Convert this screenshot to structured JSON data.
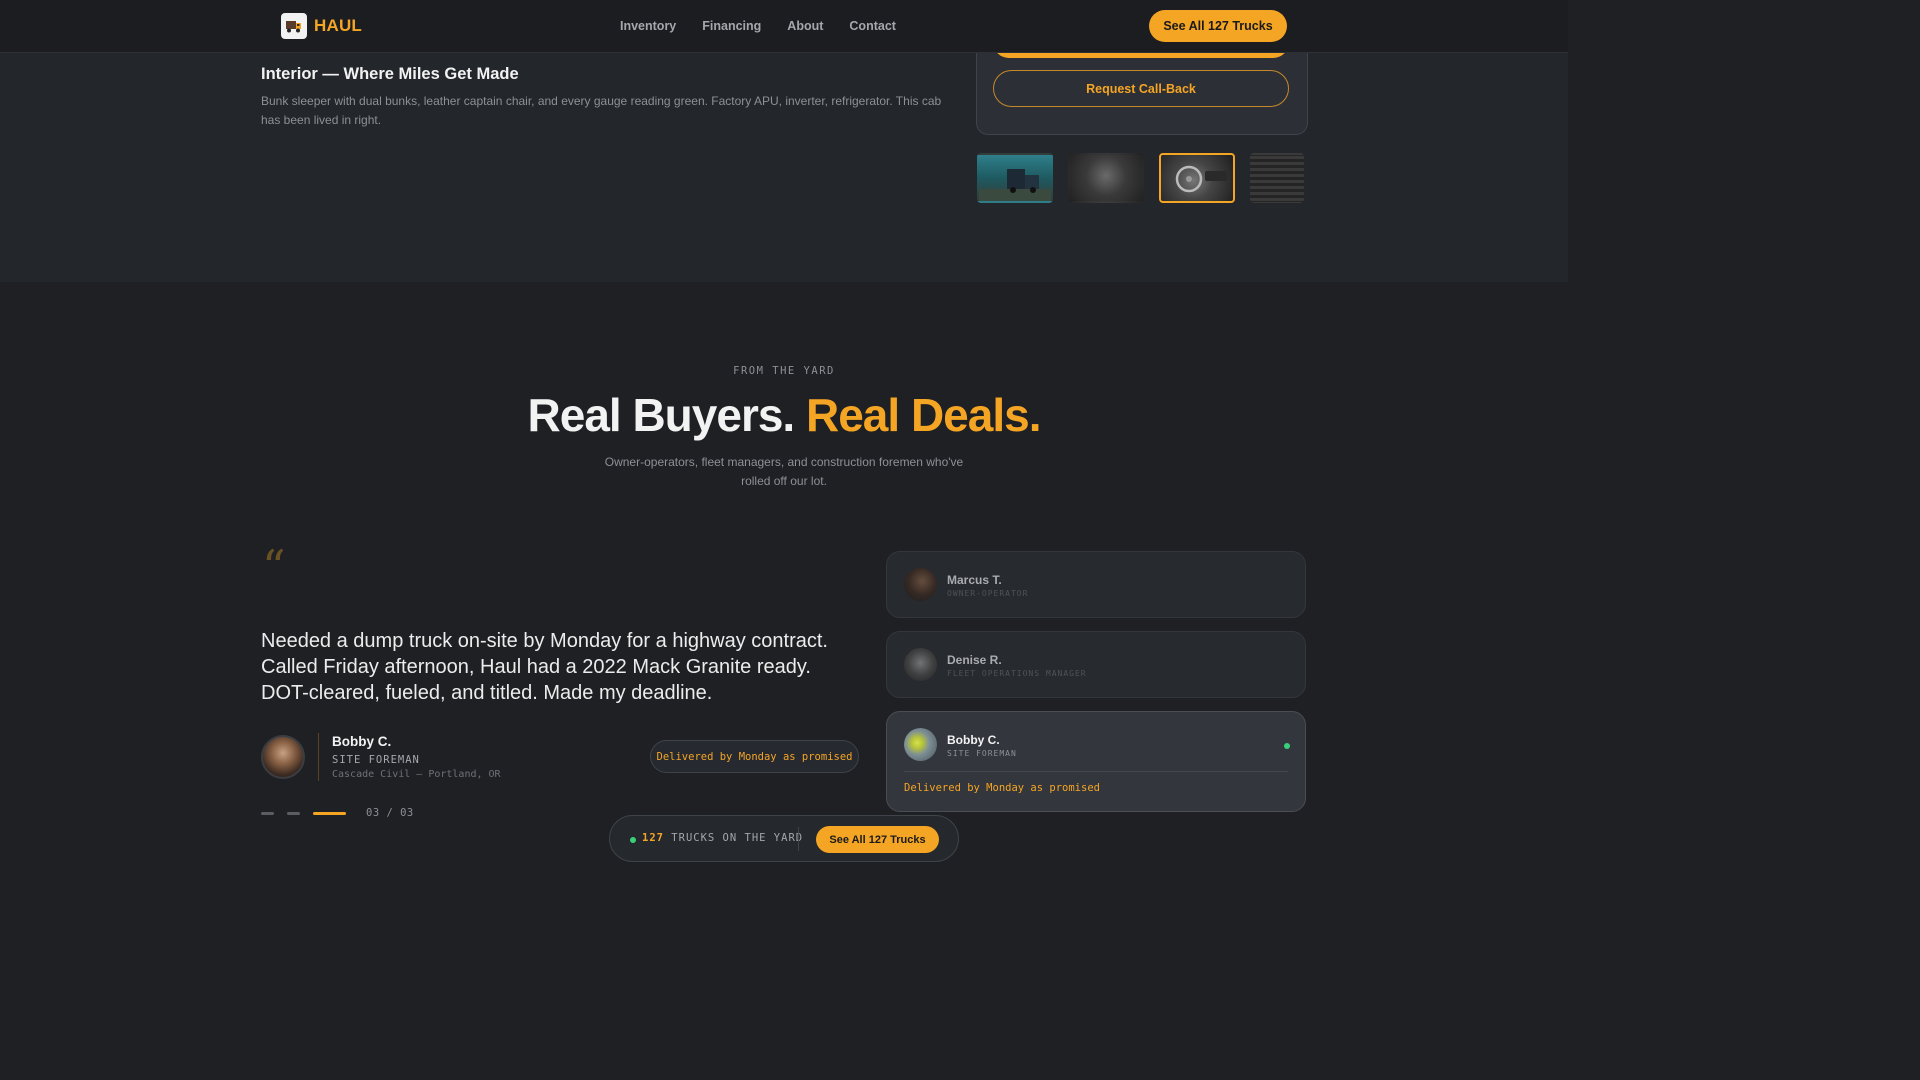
{
  "nav": {
    "brand": "HAUL",
    "links": [
      "Inventory",
      "Financing",
      "About",
      "Contact"
    ],
    "cta": "See All 127 Trucks",
    "logo_icon": "truck-icon"
  },
  "gallery": {
    "title": "Interior — Where Miles Get Made",
    "description": "Bunk sleeper with dual bunks, leather captain chair, and every gauge reading green. Factory APU, inverter, refrigerator. This cab has been lived in right.",
    "callback_label": "Request Call-Back",
    "thumbnails_active_index": 2
  },
  "testimonials": {
    "eyebrow": "FROM THE YARD",
    "headline_white": "Real Buyers.",
    "headline_orange": "Real Deals.",
    "subhead": "Owner-operators, fleet managers, and construction foremen who've rolled off our lot.",
    "quote": "Needed a dump truck on-site by Monday for a highway contract. Called Friday afternoon, Haul had a 2022 Mack Granite ready. DOT-cleared, fueled, and titled. Made my deadline.",
    "author": {
      "name": "Bobby C.",
      "role": "SITE FOREMAN",
      "org": "Cascade Civil — Portland, OR"
    },
    "highlight": "Delivered by Monday as promised",
    "counter": "03 / 03",
    "cards": [
      {
        "name": "Marcus T.",
        "role": "OWNER-OPERATOR"
      },
      {
        "name": "Denise R.",
        "role": "FLEET OPERATIONS MANAGER"
      },
      {
        "name": "Bobby C.",
        "role": "SITE FOREMAN",
        "quote": "Delivered by Monday as promised"
      }
    ]
  },
  "sticky_bar": {
    "count": "127",
    "label": "TRUCKS ON THE YARD",
    "cta": "See All 127 Trucks"
  },
  "colors": {
    "accent": "#f5a524",
    "background": "#1e2024",
    "live": "#3ad07a"
  }
}
